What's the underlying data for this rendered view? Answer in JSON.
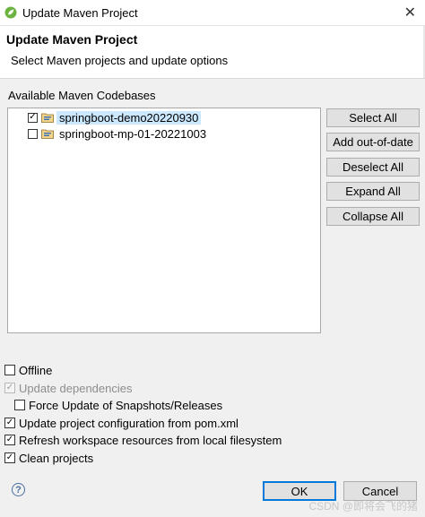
{
  "window": {
    "title": "Update Maven Project"
  },
  "banner": {
    "title": "Update Maven Project",
    "description": "Select Maven projects and update options"
  },
  "codebases": {
    "label": "Available Maven Codebases",
    "items": [
      {
        "name": "springboot-demo20220930",
        "checked": true,
        "selected": true
      },
      {
        "name": "springboot-mp-01-20221003",
        "checked": false,
        "selected": false
      }
    ]
  },
  "side_buttons": {
    "select_all": "Select All",
    "add_out_of_date": "Add out-of-date",
    "deselect_all": "Deselect All",
    "expand_all": "Expand All",
    "collapse_all": "Collapse All"
  },
  "options": {
    "offline": {
      "label": "Offline",
      "checked": false
    },
    "update_dependencies": {
      "label": "Update dependencies",
      "checked": true,
      "disabled": true
    },
    "force_update": {
      "label": "Force Update of Snapshots/Releases",
      "checked": false
    },
    "update_config": {
      "label": "Update project configuration from pom.xml",
      "checked": true
    },
    "refresh_workspace": {
      "label": "Refresh workspace resources from local filesystem",
      "checked": true
    },
    "clean_projects": {
      "label": "Clean projects",
      "checked": true
    }
  },
  "footer": {
    "help_symbol": "?",
    "ok_label": "OK",
    "cancel_label": "Cancel"
  },
  "watermark": "CSDN @即将会飞的猪",
  "colors": {
    "selection": "#cce8ff",
    "default_button_border": "#0078d7"
  }
}
